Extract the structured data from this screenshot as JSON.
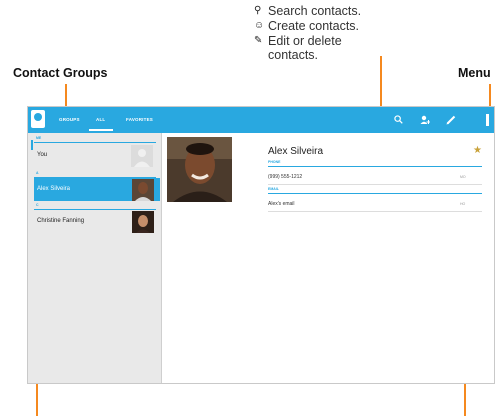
{
  "callouts": {
    "items": [
      {
        "icon": "search-icon",
        "glyph": "⚲",
        "text": "Search contacts."
      },
      {
        "icon": "add-contact-icon",
        "glyph": "☺",
        "text": "Create contacts."
      },
      {
        "icon": "pencil-icon",
        "glyph": "✎",
        "text": "Edit or delete"
      },
      {
        "icon": "",
        "glyph": "",
        "text": "contacts."
      }
    ],
    "contact_groups": "Contact Groups",
    "menu": "Menu"
  },
  "actionbar": {
    "tabs": [
      "GROUPS",
      "ALL",
      "FAVORITES"
    ],
    "active_tab": "ALL",
    "icons": [
      "search-icon",
      "add-contact-icon",
      "pencil-icon",
      "menu-icon"
    ]
  },
  "list": {
    "sections": [
      {
        "header": "ME",
        "items": [
          {
            "name": "You",
            "selected": false
          }
        ]
      },
      {
        "header": "A",
        "items": [
          {
            "name": "Alex Silveira",
            "selected": true
          }
        ]
      },
      {
        "header": "C",
        "items": [
          {
            "name": "Christine Fanning",
            "selected": false
          }
        ]
      }
    ]
  },
  "detail": {
    "name": "Alex Silveira",
    "phone_header": "PHONE",
    "phone": "(999) 555-1212",
    "phone_type": "MO",
    "email_header": "EMAIL",
    "email": "Alex's email",
    "email_type": "HO"
  },
  "colors": {
    "accent": "#29a8e0",
    "callout": "#f5891f",
    "star": "#c9a23a"
  }
}
